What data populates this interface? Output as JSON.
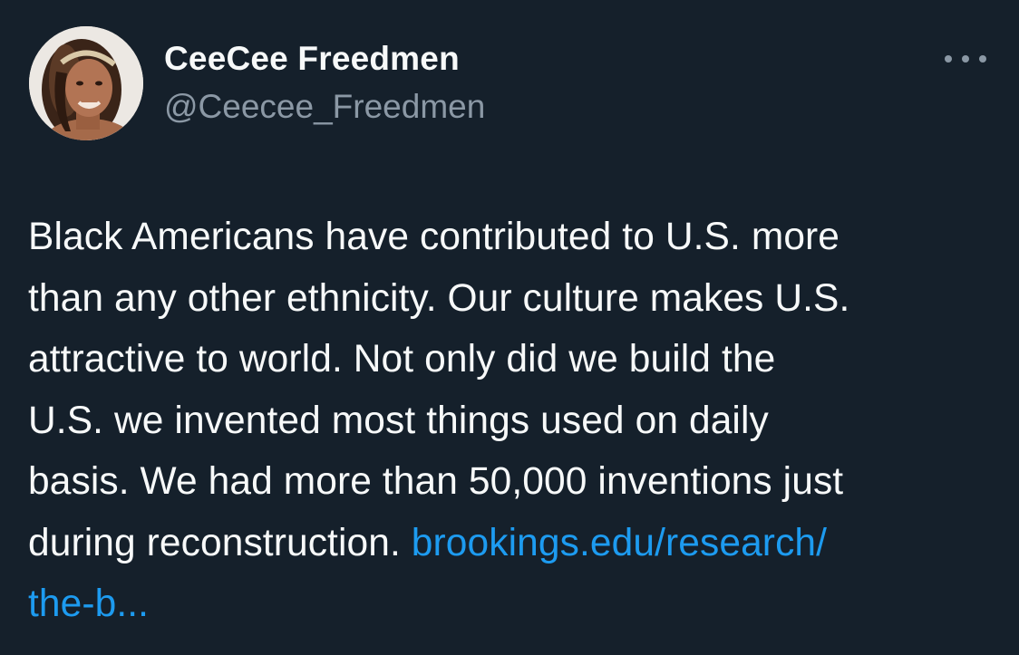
{
  "author": {
    "display_name": "CeeCee Freedmen",
    "handle": "@Ceecee_Freedmen",
    "avatar_icon": "profile-photo"
  },
  "menu": {
    "icon": "more-horizontal-icon"
  },
  "tweet": {
    "lines": [
      "Black Americans have contributed to U.S. more",
      "than any other ethnicity. Our culture makes U.S.",
      "attractive to world. Not only did we build the",
      "U.S. we invented most things used on daily",
      "basis. We had more than 50,000 inventions just",
      "during reconstruction. "
    ],
    "link_line1": "brookings.edu/research/",
    "link_line2": "the-b..."
  },
  "colors": {
    "background": "#15202b",
    "text": "#f7f9f9",
    "secondary": "#8b98a5",
    "link": "#1d9bf0"
  }
}
